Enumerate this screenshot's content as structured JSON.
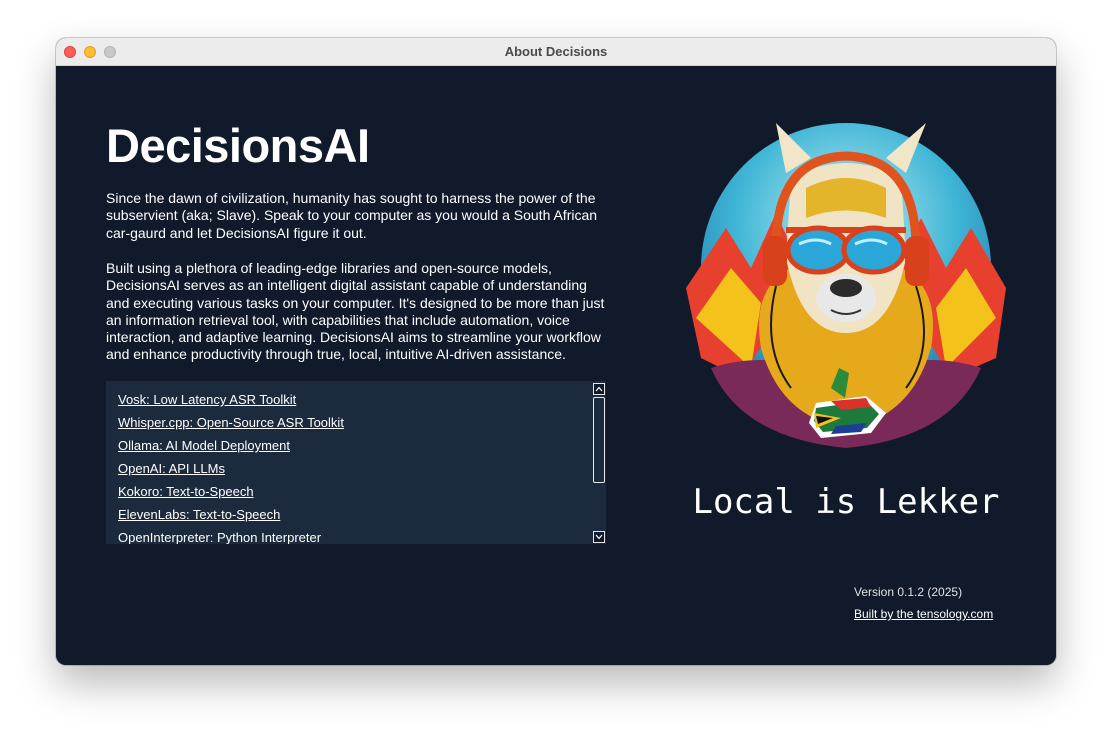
{
  "window": {
    "title": "About Decisions"
  },
  "about": {
    "app_name": "DecisionsAI",
    "intro": "Since the dawn of civilization, humanity has sought to harness the power of the subservient (aka; Slave). Speak to your computer as you would a South African car-gaurd and let DecisionsAI figure it out.",
    "description": "Built using a plethora of leading-edge libraries and open-source models, DecisionsAI serves as an intelligent digital assistant capable of understanding and executing various tasks on your computer. It's designed to be more than just an information retrieval tool, with capabilities that include automation, voice interaction, and adaptive learning. DecisionsAI aims to streamline your workflow and enhance productivity through true, local, intuitive AI-driven assistance."
  },
  "credits": {
    "items": [
      "Vosk: Low Latency ASR Toolkit",
      "Whisper.cpp: Open-Source ASR Toolkit",
      "Ollama: AI Model Deployment",
      "OpenAI: API LLMs",
      "Kokoro: Text-to-Speech",
      "ElevenLabs: Text-to-Speech",
      "OpenInterpreter: Python Interpreter"
    ]
  },
  "mascot": {
    "caption": "Local is Lekker",
    "icon": "llama-mascot-icon"
  },
  "footer": {
    "version": "Version 0.1.2 (2025)",
    "built_by": "Built by the tensology.com"
  },
  "colors": {
    "background": "#101a2b",
    "list_background": "#1c2a3e",
    "text": "#ffffff"
  }
}
